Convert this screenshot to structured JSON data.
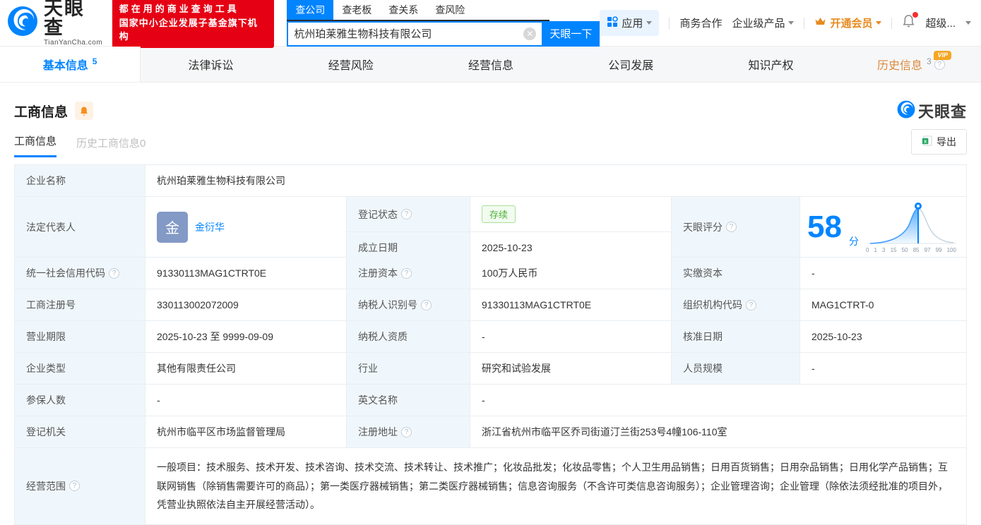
{
  "header": {
    "logo": {
      "name": "天眼查",
      "domain": "TianYanCha.com"
    },
    "promo": {
      "line1": "都在用的商业查询工具",
      "line2": "国家中小企业发展子基金旗下机构"
    },
    "search": {
      "tabs": [
        {
          "label": "查公司"
        },
        {
          "label": "查老板"
        },
        {
          "label": "查关系"
        },
        {
          "label": "查风险"
        }
      ],
      "value": "杭州珀莱雅生物科技有限公司",
      "button_label": "天眼一下"
    },
    "menu": {
      "apps": "应用",
      "biz_cooperation": "商务合作",
      "enterprise_products": "企业级产品",
      "open_vip": "开通会员",
      "more": "超级..."
    }
  },
  "nav": {
    "tabs": [
      {
        "label": "基本信息",
        "count": "5"
      },
      {
        "label": "法律诉讼"
      },
      {
        "label": "经营风险"
      },
      {
        "label": "经营信息"
      },
      {
        "label": "公司发展"
      },
      {
        "label": "知识产权"
      },
      {
        "label": "历史信息",
        "count": "3",
        "vip": "VIP"
      }
    ]
  },
  "section": {
    "title": "工商信息",
    "brand": "天眼查",
    "subtabs": [
      {
        "label": "工商信息"
      },
      {
        "label": "历史工商信息0"
      }
    ],
    "export_label": "导出"
  },
  "table": {
    "company_name": {
      "label": "企业名称",
      "value": "杭州珀莱雅生物科技有限公司"
    },
    "legal_rep": {
      "label": "法定代表人",
      "avatar": "金",
      "name": "金衍华"
    },
    "reg_status": {
      "label": "登记状态",
      "value": "存续"
    },
    "establish_date": {
      "label": "成立日期",
      "value": "2025-10-23"
    },
    "score": {
      "label": "天眼评分",
      "value": "58",
      "unit": "分"
    },
    "credit_code": {
      "label": "统一社会信用代码",
      "value": "91330113MAG1CTRT0E"
    },
    "reg_capital": {
      "label": "注册资本",
      "value": "100万人民币"
    },
    "paid_capital": {
      "label": "实缴资本",
      "value": "-"
    },
    "reg_number": {
      "label": "工商注册号",
      "value": "330113002072009"
    },
    "taxpayer_id": {
      "label": "纳税人识别号",
      "value": "91330113MAG1CTRT0E"
    },
    "org_code": {
      "label": "组织机构代码",
      "value": "MAG1CTRT-0"
    },
    "business_term": {
      "label": "营业期限",
      "value": "2025-10-23 至 9999-09-09"
    },
    "taxpayer_quality": {
      "label": "纳税人资质",
      "value": "-"
    },
    "approve_date": {
      "label": "核准日期",
      "value": "2025-10-23"
    },
    "company_type": {
      "label": "企业类型",
      "value": "其他有限责任公司"
    },
    "industry": {
      "label": "行业",
      "value": "研究和试验发展"
    },
    "staff_size": {
      "label": "人员规模",
      "value": "-"
    },
    "insured_count": {
      "label": "参保人数",
      "value": "-"
    },
    "english_name": {
      "label": "英文名称",
      "value": "-"
    },
    "reg_authority": {
      "label": "登记机关",
      "value": "杭州市临平区市场监督管理局"
    },
    "reg_address": {
      "label": "注册地址",
      "value": "浙江省杭州市临平区乔司街道汀兰街253号4幢106-110室"
    },
    "business_scope": {
      "label": "经营范围",
      "value": "一般项目：技术服务、技术开发、技术咨询、技术交流、技术转让、技术推广；化妆品批发；化妆品零售；个人卫生用品销售；日用百货销售；日用杂品销售；日用化学产品销售；互联网销售（除销售需要许可的商品）；第一类医疗器械销售；第二类医疗器械销售；信息咨询服务（不含许可类信息咨询服务）；企业管理咨询；企业管理（除依法须经批准的项目外，凭营业执照依法自主开展经营活动）。"
    }
  },
  "score_chart": {
    "type": "area",
    "description": "percentile bell curve",
    "ticks": [
      "0",
      "1",
      "3",
      "15",
      "50",
      "85",
      "97",
      "99",
      "100"
    ],
    "marker_value": "58"
  },
  "colors": {
    "brand_blue": "#0084ff",
    "promo_red": "#e60014",
    "vip_orange": "#f5a623",
    "status_green": "#4cb236",
    "label_bg": "#f0f7fc"
  }
}
